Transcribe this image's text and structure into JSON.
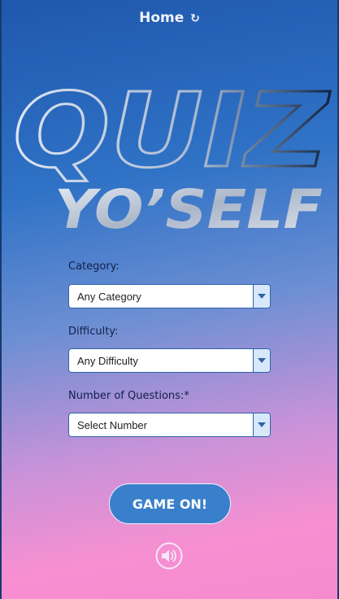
{
  "header": {
    "home_label": "Home",
    "refresh_glyph": "↻"
  },
  "logo": {
    "line1": "QUIZ",
    "line2": "YO’SELF"
  },
  "form": {
    "category": {
      "label": "Category:",
      "value": "Any Category"
    },
    "difficulty": {
      "label": "Difficulty:",
      "value": "Any Difficulty"
    },
    "questions": {
      "label": "Number of Questions:*",
      "value": "Select Number"
    }
  },
  "actions": {
    "start_label": "GAME ON!"
  },
  "icons": {
    "sound": "speaker-icon",
    "refresh": "refresh-icon",
    "dropdown": "chevron-down-icon"
  },
  "colors": {
    "accent": "#3a7fcb",
    "select_border": "#2f62a8",
    "label_text": "#12204a"
  }
}
